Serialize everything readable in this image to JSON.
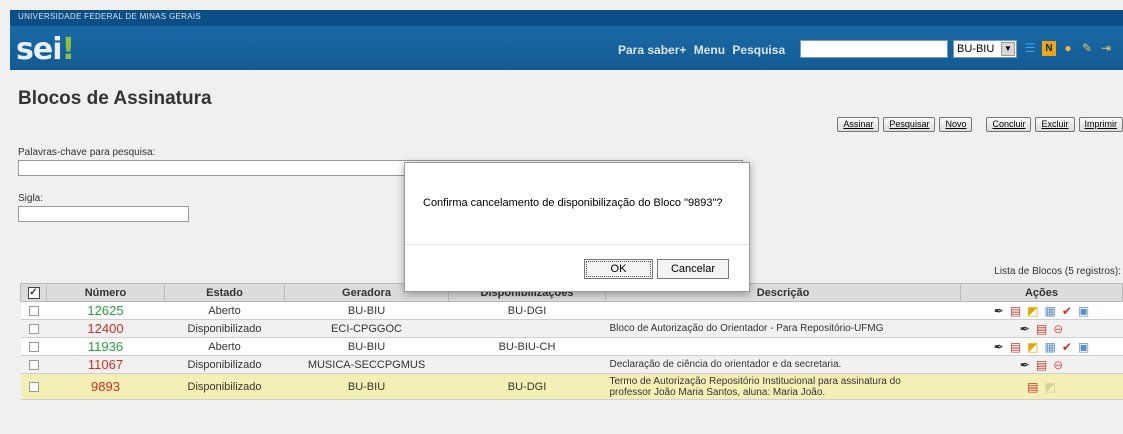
{
  "header": {
    "university": "UNIVERSIDADE FEDERAL DE MINAS GERAIS",
    "logo_main": "sei",
    "logo_mark": "!",
    "links": [
      "Para saber+",
      "Menu",
      "Pesquisa"
    ],
    "search_value": "",
    "unit_selected": "BU-BIU",
    "icons": [
      "list-icon",
      "notification-badge-icon",
      "user-icon",
      "tools-icon",
      "exit-icon"
    ]
  },
  "page": {
    "title": "Blocos de Assinatura",
    "buttons": [
      "Assinar",
      "Pesquisar",
      "Novo",
      "Concluir",
      "Excluir",
      "Imprimir"
    ],
    "keywords_label": "Palavras-chave para pesquisa:",
    "sigla_label": "Sigla:",
    "list_caption": "Lista de Blocos (5 registros):"
  },
  "table": {
    "columns": [
      "Número",
      "Estado",
      "Geradora",
      "Disponibilizações",
      "Descrição",
      "Ações"
    ],
    "rows": [
      {
        "numero": "12625",
        "estado": "Aberto",
        "geradora": "BU-BIU",
        "disp": "BU-DGI",
        "descricao": "",
        "color": "#2a9e3a"
      },
      {
        "numero": "12400",
        "estado": "Disponibilizado",
        "geradora": "ECI-CPGGOC",
        "disp": "",
        "descricao": "Bloco de Autorização do Orientador - Para Repositório-UFMG",
        "color": "#d42c21"
      },
      {
        "numero": "11936",
        "estado": "Aberto",
        "geradora": "BU-BIU",
        "disp": "BU-BIU-CH",
        "descricao": "",
        "color": "#2a9e3a"
      },
      {
        "numero": "11067",
        "estado": "Disponibilizado",
        "geradora": "MUSICA-SECCPGMUS",
        "disp": "",
        "descricao": "Declaração de ciência do orientador e da secretaria.",
        "color": "#d42c21"
      },
      {
        "numero": "9893",
        "estado": "Disponibilizado",
        "geradora": "BU-BIU",
        "disp": "BU-DGI",
        "descricao_line1": "Termo de Autorização Repositório Institucional para assinatura do",
        "descricao_line2": "professor João Maria Santos, aluna: Maria João.",
        "color": "#d42c21"
      }
    ]
  },
  "dialog": {
    "message": "Confirma cancelamento de disponibilização do Bloco \"9893\"?",
    "ok_label": "OK",
    "cancel_label": "Cancelar"
  }
}
